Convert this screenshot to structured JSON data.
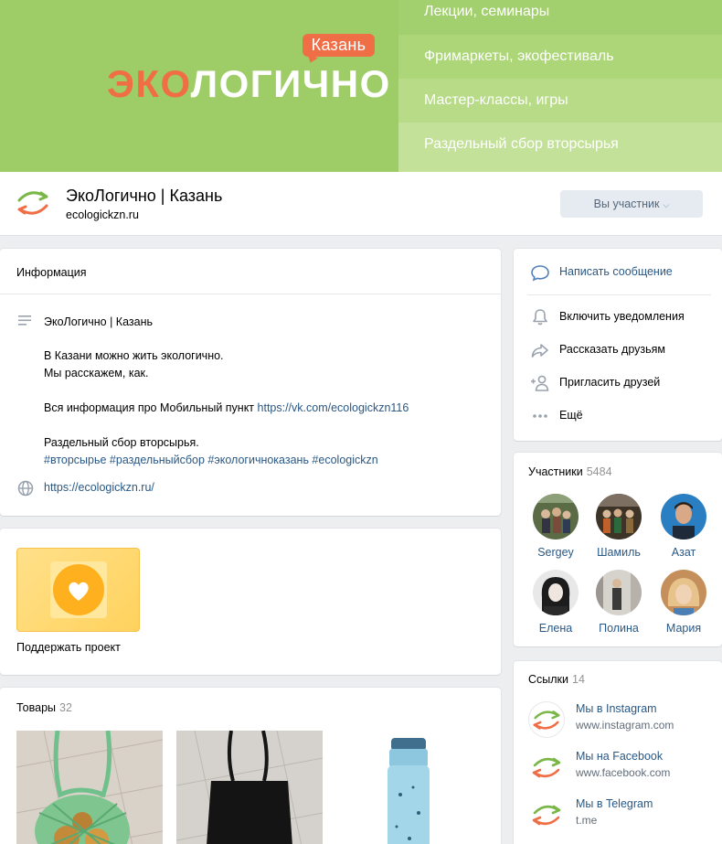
{
  "cover": {
    "city": "Казань",
    "brand_part1": "ЭКО",
    "brand_part2": "ЛОГИЧНО",
    "menu": [
      "Лекции, семинары",
      "Фримаркеты, экофестиваль",
      "Мастер-классы, игры",
      "Раздельный сбор вторсырья"
    ]
  },
  "group": {
    "name": "ЭкоЛогично | Казань",
    "site": "ecologickzn.ru",
    "member_button": "Вы участник",
    "chevron": "⌵"
  },
  "info": {
    "title": "Информация",
    "name_line": "ЭкоЛогично | Казань",
    "desc1": "В Казани можно жить экологично.",
    "desc2": "Мы расскажем, как.",
    "mobile_text": "Вся информация про Мобильный пункт ",
    "mobile_link": "https://vk.com/ecologickzn116",
    "sorting": "Раздельный сбор вторсырья.",
    "hashtags": "#вторсырье #раздельныйсбор #экологичноказань #ecologickzn",
    "website": "https://ecologickzn.ru/"
  },
  "support": {
    "label": "Поддержать проект"
  },
  "goods": {
    "title": "Товары",
    "count": "32"
  },
  "actions": [
    {
      "label": "Написать сообщение",
      "icon": "message-icon"
    },
    {
      "label": "Включить уведомления",
      "icon": "bell-icon"
    },
    {
      "label": "Рассказать друзьям",
      "icon": "share-icon"
    },
    {
      "label": "Пригласить друзей",
      "icon": "add-user-icon"
    },
    {
      "label": "Ещё",
      "icon": "more-icon"
    }
  ],
  "members": {
    "title": "Участники",
    "count": "5484",
    "list": [
      {
        "name": "Sergey"
      },
      {
        "name": "Шамиль"
      },
      {
        "name": "Азат"
      },
      {
        "name": "Елена"
      },
      {
        "name": "Полина"
      },
      {
        "name": "Мария"
      }
    ]
  },
  "links": {
    "title": "Ссылки",
    "count": "14",
    "list": [
      {
        "title": "Мы в Instagram",
        "url": "www.instagram.com"
      },
      {
        "title": "Мы на Facebook",
        "url": "www.facebook.com"
      },
      {
        "title": "Мы в Telegram",
        "url": "t.me"
      }
    ]
  },
  "colors": {
    "cover_green": "#9ecd68",
    "brand_orange": "#ef6e45",
    "link_blue": "#2a5885"
  }
}
